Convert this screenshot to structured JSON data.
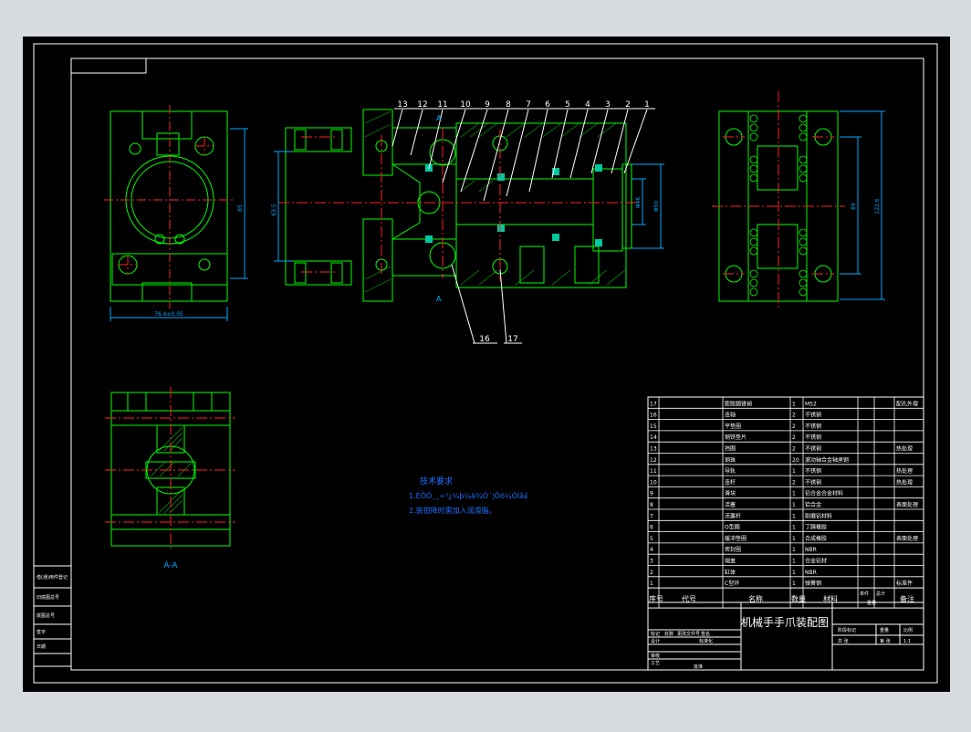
{
  "drawing": {
    "title": "机械手手爪装配图",
    "tech_req_heading": "技术要求",
    "tech_req_lines": [
      "1.ÈÕÔ¸¸÷²¿¼þ¼ä¾Ó´¦Ôö¼ÓÍâ£",
      "2.装钳降时需加入润滑脂。"
    ],
    "section_label": "A-A",
    "section_mark": "A",
    "callouts": [
      "13",
      "12",
      "11",
      "10",
      "9",
      "8",
      "7",
      "6",
      "5",
      "4",
      "3",
      "2",
      "1"
    ],
    "callouts_lower": [
      "16",
      "17"
    ],
    "dims": {
      "left_width": "76.4±0.05",
      "left_height": "85",
      "main_left": "63.5",
      "main_bore_a": "Φ46",
      "main_bore_b": "Φ50",
      "right_a": "89",
      "right_b": "122.6"
    }
  },
  "bom": {
    "rows": [
      {
        "no": "17",
        "name": "膨胀圆锥销",
        "qty": "1",
        "material": "M52",
        "note": "配孔外理"
      },
      {
        "no": "16",
        "name": "连轴",
        "qty": "2",
        "material": "不锈钢",
        "note": ""
      },
      {
        "no": "15",
        "name": "平垫圈",
        "qty": "2",
        "material": "不锈钢",
        "note": ""
      },
      {
        "no": "14",
        "name": "钢铁垫片",
        "qty": "2",
        "material": "不锈钢",
        "note": ""
      },
      {
        "no": "13",
        "name": "挡圈",
        "qty": "2",
        "material": "不锈钢",
        "note": "热处理"
      },
      {
        "no": "12",
        "name": "钢珠",
        "qty": "20",
        "material": "滚动轴合金轴承钢",
        "note": ""
      },
      {
        "no": "11",
        "name": "导轨",
        "qty": "1",
        "material": "不锈钢",
        "note": "热处理"
      },
      {
        "no": "10",
        "name": "连杆",
        "qty": "2",
        "material": "不锈钢",
        "note": "热处理"
      },
      {
        "no": "9",
        "name": "滑块",
        "qty": "1",
        "material": "铝合金合金材料",
        "note": ""
      },
      {
        "no": "8",
        "name": "活塞",
        "qty": "1",
        "material": "铝合金",
        "note": "表面处理"
      },
      {
        "no": "7",
        "name": "活塞杆",
        "qty": "1",
        "material": "耐磨铝材料",
        "note": ""
      },
      {
        "no": "6",
        "name": "O型圈",
        "qty": "1",
        "material": "丁腈橡胶",
        "note": ""
      },
      {
        "no": "5",
        "name": "缓冲垫圈",
        "qty": "1",
        "material": "合成橡胶",
        "note": "表面处理"
      },
      {
        "no": "4",
        "name": "密封圈",
        "qty": "1",
        "material": "NBR",
        "note": ""
      },
      {
        "no": "3",
        "name": "端盖",
        "qty": "1",
        "material": "合金铝材",
        "note": ""
      },
      {
        "no": "2",
        "name": "缸体",
        "qty": "1",
        "material": "NBR",
        "note": ""
      },
      {
        "no": "1",
        "name": "C型环",
        "qty": "1",
        "material": "弹簧钢",
        "note": "标准件"
      }
    ],
    "header": {
      "no": "序号",
      "code": "代号",
      "name": "名称",
      "qty": "数量",
      "material": "材料",
      "unit_single": "单件",
      "unit_total": "总计",
      "weight": "重量",
      "note": "备注"
    }
  },
  "title_block": {
    "name": "机械手手爪装配图",
    "cells": [
      "标记",
      "处数",
      "更改文件号",
      "签名",
      "设计",
      "标准化",
      "阶段标记",
      "重量",
      "比例",
      "审核",
      "工艺",
      "批准",
      "共 张",
      "第 张"
    ],
    "scale": "1:1"
  },
  "side_strip": [
    "借(通)用件登记",
    "旧底图总号",
    "底图总号",
    "签字",
    "日期"
  ],
  "colors": {
    "background": "#000000",
    "frame": "#ffffff",
    "part": "#00ff00",
    "centerline": "#ff2222",
    "dimension": "#00aaff",
    "text": "#ffffff",
    "text_blue": "#1e6fff"
  }
}
